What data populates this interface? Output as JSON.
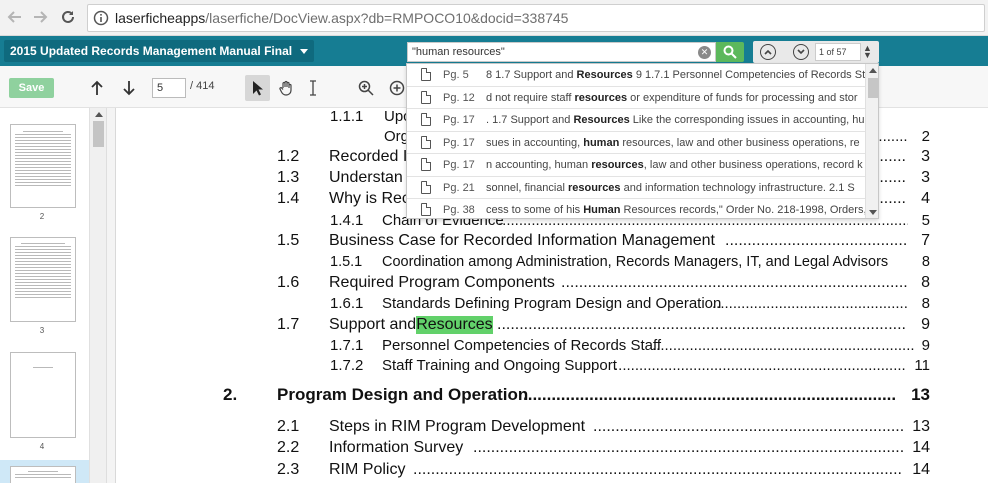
{
  "browser": {
    "url_host": "laserficheapps",
    "url_path": "/laserfiche/DocView.aspx?db=RMPOCO10&docid=338745"
  },
  "header": {
    "doc_title": "2015 Updated Records Management Manual Final",
    "search_value": "\"human resources\"",
    "hit_count": "1 of 57",
    "accent_color": "#167d93",
    "search_button_color": "#5cb85c"
  },
  "toolbar": {
    "save_label": "Save",
    "page_number": "5",
    "page_total": "/ 414"
  },
  "thumbnails": [
    {
      "label": "2"
    },
    {
      "label": "3"
    },
    {
      "label": "4"
    }
  ],
  "search_results": [
    {
      "page": "Pg. 5",
      "pre": "8 1.7 Support and ",
      "bold": "Resources",
      "post": " 9 1.7.1 Personnel Competencies of Records Sta"
    },
    {
      "page": "Pg. 12",
      "pre": "d not require staff ",
      "bold": "resources",
      "post": " or expenditure of funds for processing and stor"
    },
    {
      "page": "Pg. 17",
      "pre": ". 1.7 Support and ",
      "bold": "Resources",
      "post": " Like the corresponding issues in accounting, hu"
    },
    {
      "page": "Pg. 17",
      "pre": "sues in accounting, ",
      "bold": "human",
      "post": " resources, law and other business operations, re"
    },
    {
      "page": "Pg. 17",
      "pre": "n accounting, human ",
      "bold": "resources",
      "post": ", law and other business operations, record k"
    },
    {
      "page": "Pg. 21",
      "pre": "sonnel, financial ",
      "bold": "resources",
      "post": " and information technology infrastructure. 2.1 S"
    },
    {
      "page": "Pg. 38",
      "pre": "cess to some of his ",
      "bold": "Human",
      "post": " Resources records,\" Order No. 218-1998, Orders,"
    }
  ],
  "toc": [
    {
      "num": "1.1.1",
      "title": "Upc",
      "page": ""
    },
    {
      "num": "",
      "title": "Org",
      "page": "2"
    },
    {
      "num": "1.2",
      "title": "Recorded I",
      "page": "3"
    },
    {
      "num": "1.3",
      "title": "Understan",
      "page": "3"
    },
    {
      "num": "1.4",
      "title": "Why is Rec",
      "page": "4"
    },
    {
      "num": "1.4.1",
      "title": "Chain of Evidence",
      "page": "5"
    },
    {
      "num": "1.5",
      "title": "Business Case for Recorded Information Management",
      "page": "7"
    },
    {
      "num": "1.5.1",
      "title": "Coordination among Administration, Records Managers, IT, and Legal Advisors",
      "page": "8"
    },
    {
      "num": "1.6",
      "title": "Required Program Components",
      "page": "8"
    },
    {
      "num": "1.6.1",
      "title": "Standards Defining Program Design and Operation",
      "page": "8"
    },
    {
      "num": "1.7",
      "title_pre": "Support and ",
      "title_hl": "Resources",
      "page": "9"
    },
    {
      "num": "1.7.1",
      "title": "Personnel Competencies of Records Staff",
      "page": "9"
    },
    {
      "num": "1.7.2",
      "title": "Staff Training and Ongoing Support",
      "page": "11"
    },
    {
      "num": "2.",
      "title": "Program Design and Operation",
      "page": "13"
    },
    {
      "num": "2.1",
      "title": "Steps in RIM Program Development",
      "page": "13"
    },
    {
      "num": "2.2",
      "title": "Information Survey",
      "page": "14"
    },
    {
      "num": "2.3",
      "title": "RIM Policy",
      "page": "14"
    }
  ]
}
